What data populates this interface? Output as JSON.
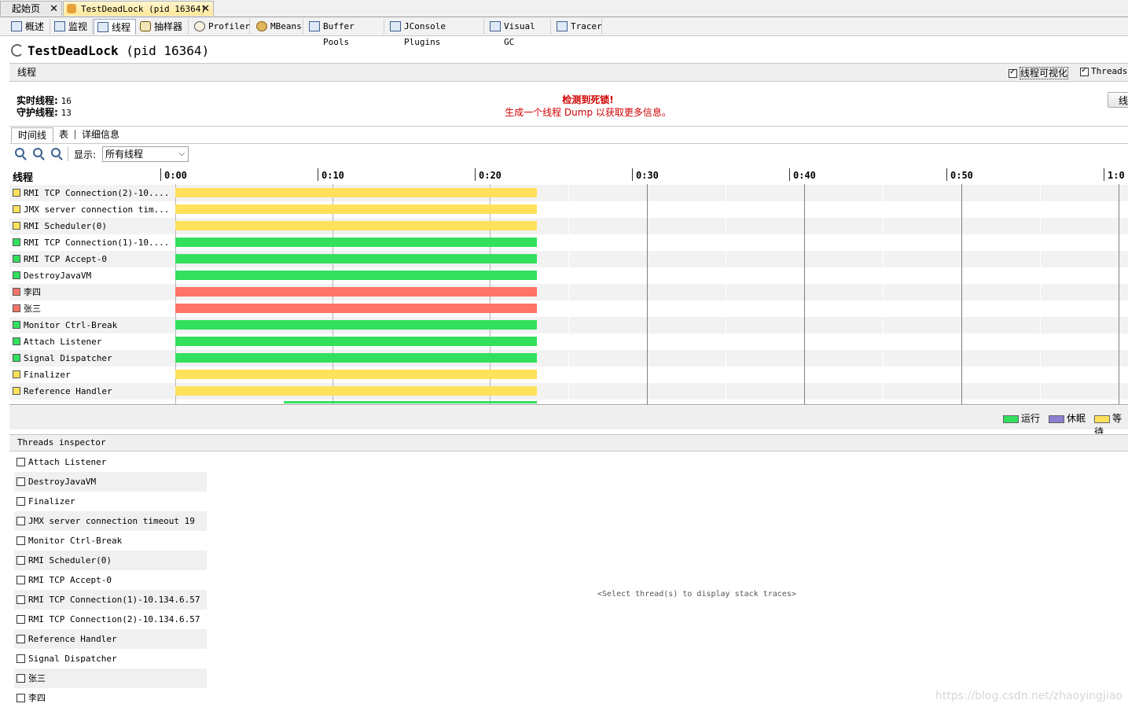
{
  "doc_tabs": [
    {
      "label": "起始页",
      "active": false
    },
    {
      "label": "TestDeadLock (pid 16364)",
      "active": true
    }
  ],
  "close_glyph": "✕",
  "view_tabs": [
    {
      "label": "概述",
      "icon": "overview-icon"
    },
    {
      "label": "监视",
      "icon": "monitor-icon"
    },
    {
      "label": "线程",
      "icon": "threads-icon",
      "active": true
    },
    {
      "label": "抽样器",
      "icon": "sampler-icon"
    },
    {
      "label": "Profiler",
      "icon": "profiler-icon"
    },
    {
      "label": "MBeans",
      "icon": "mbeans-icon"
    },
    {
      "label": "Buffer Pools",
      "icon": "buffer-pools-icon"
    },
    {
      "label": "JConsole Plugins",
      "icon": "jconsole-icon"
    },
    {
      "label": "Visual GC",
      "icon": "visual-gc-icon"
    },
    {
      "label": "Tracer",
      "icon": "tracer-icon"
    }
  ],
  "header": {
    "app": "TestDeadLock",
    "pid": "(pid 16364)"
  },
  "section": {
    "title": "线程",
    "options": [
      {
        "label": "线程可视化",
        "checked": true
      },
      {
        "label": "Threads",
        "checked": true
      }
    ]
  },
  "stats": {
    "live_label": "实时线程:",
    "live_value": "16",
    "daemon_label": "守护线程:",
    "daemon_value": "13"
  },
  "deadlock": {
    "title": "检测到死锁!",
    "message": "生成一个线程 Dump 以获取更多信息。"
  },
  "dump_button": "线",
  "sub_tabs": [
    {
      "label": "时间线",
      "active": true
    },
    {
      "label": "表",
      "active": false
    },
    {
      "label": "详细信息",
      "active": false
    }
  ],
  "display": {
    "label": "显示:",
    "value": "所有线程"
  },
  "timeline": {
    "column_title": "线程",
    "ticks": [
      "0:00",
      "0:10",
      "0:20",
      "0:30",
      "0:40",
      "0:50",
      "1:0"
    ],
    "elapsed_seconds": 23,
    "rows": [
      {
        "name": "RMI TCP Connection(2)-10....",
        "state": "waiting"
      },
      {
        "name": "JMX server connection tim...",
        "state": "waiting"
      },
      {
        "name": "RMI Scheduler(0)",
        "state": "waiting"
      },
      {
        "name": "RMI TCP Connection(1)-10....",
        "state": "running"
      },
      {
        "name": "RMI TCP Accept-0",
        "state": "running"
      },
      {
        "name": "DestroyJavaVM",
        "state": "running"
      },
      {
        "name": "李四",
        "state": "monitor"
      },
      {
        "name": "张三",
        "state": "monitor"
      },
      {
        "name": "Monitor Ctrl-Break",
        "state": "running"
      },
      {
        "name": "Attach Listener",
        "state": "running"
      },
      {
        "name": "Signal Dispatcher",
        "state": "running"
      },
      {
        "name": "Finalizer",
        "state": "waiting"
      },
      {
        "name": "Reference Handler",
        "state": "waiting"
      }
    ],
    "partial_row": {
      "state": "running",
      "start_seconds": 6.9
    }
  },
  "state_colors": {
    "running": "#32e05e",
    "sleeping": "#8a7fd0",
    "waiting": "#ffe15c",
    "monitor": "#ff7466"
  },
  "legend": [
    {
      "label": "运行",
      "state": "running"
    },
    {
      "label": "休眠",
      "state": "sleeping"
    },
    {
      "label": "等待",
      "state": "waiting"
    }
  ],
  "inspector": {
    "title": "Threads inspector",
    "items": [
      "Attach Listener",
      "DestroyJavaVM",
      "Finalizer",
      "JMX server connection timeout 19",
      "Monitor Ctrl-Break",
      "RMI Scheduler(0)",
      "RMI TCP Accept-0",
      "RMI TCP Connection(1)-10.134.6.57",
      "RMI TCP Connection(2)-10.134.6.57",
      "Reference Handler",
      "Signal Dispatcher",
      "张三",
      "李四"
    ],
    "placeholder": "<Select thread(s) to display stack traces>"
  },
  "watermark": "https://blog.csdn.net/zhaoyingjiao"
}
